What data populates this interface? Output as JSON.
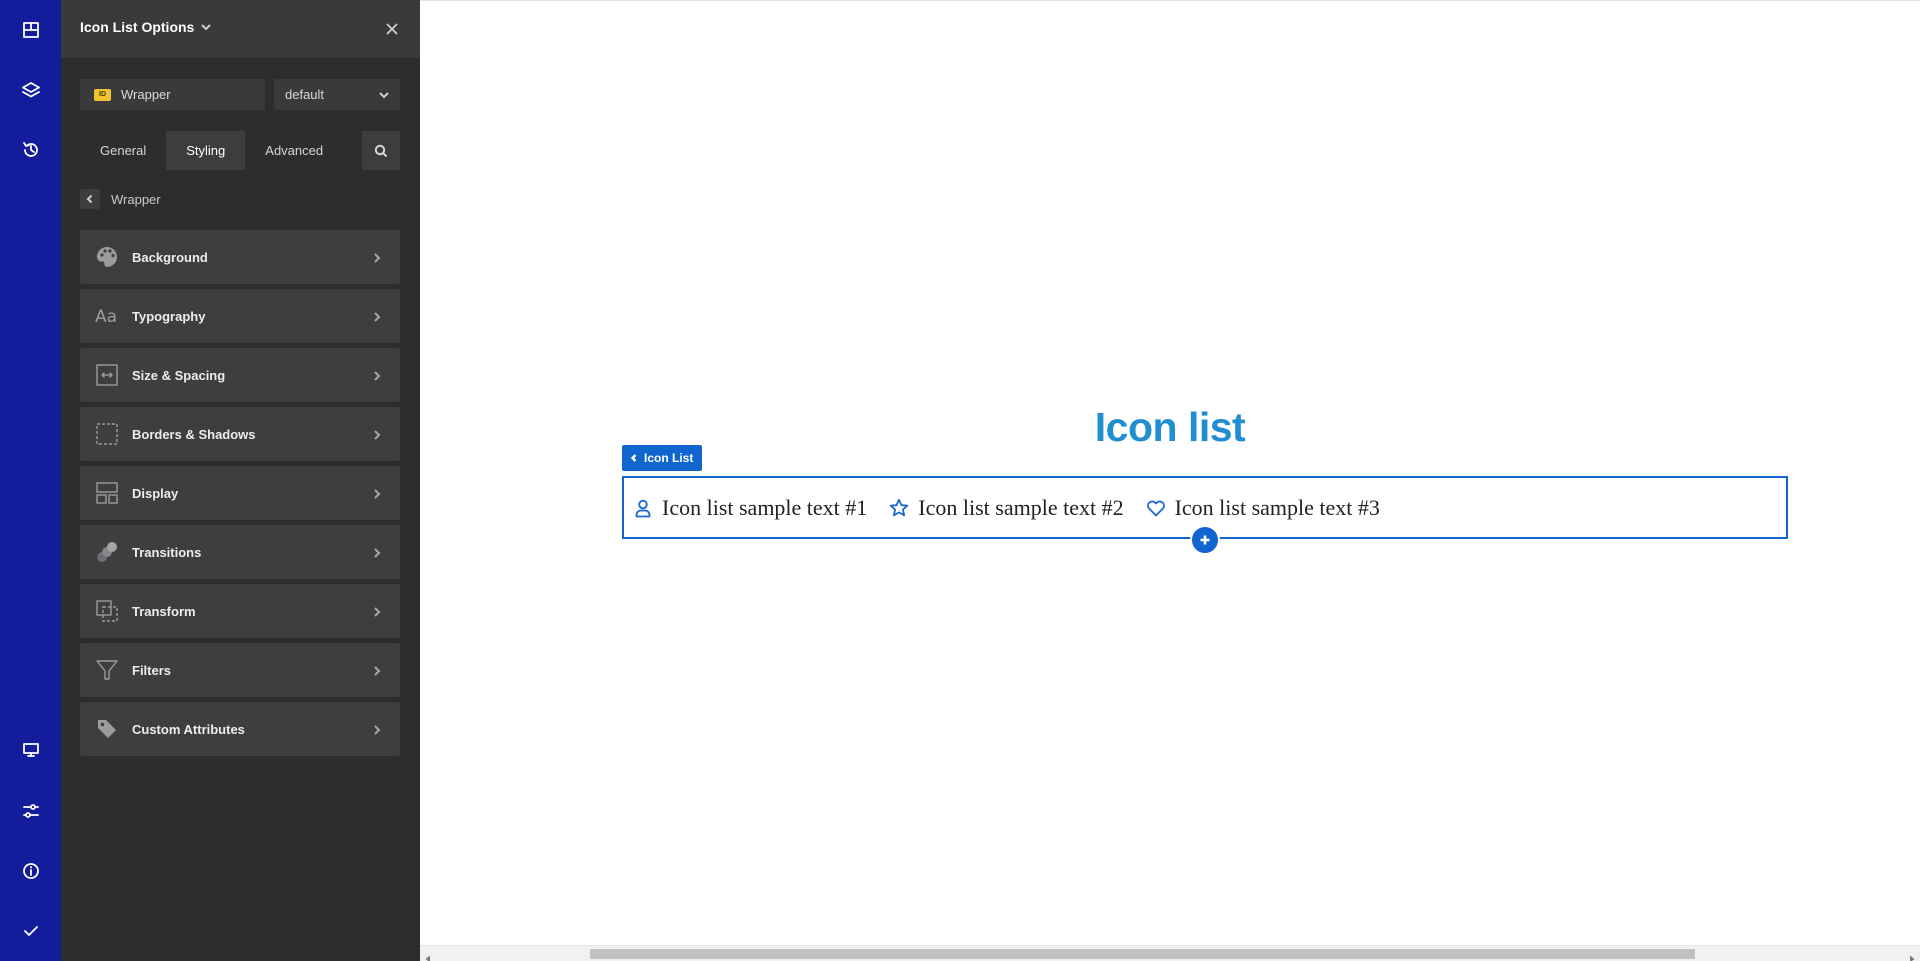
{
  "rail": {
    "top_icons": [
      "elements-icon",
      "layers-icon",
      "history-icon"
    ],
    "bottom_icons": [
      "desktop-icon",
      "settings-icon",
      "info-icon",
      "check-icon"
    ]
  },
  "panel": {
    "title": "Icon List Options",
    "selector": {
      "id_badge": "ID",
      "class_value": "Wrapper",
      "state_value": "default"
    },
    "tabs": [
      {
        "label": "General"
      },
      {
        "label": "Styling"
      },
      {
        "label": "Advanced"
      }
    ],
    "active_tab": "Styling",
    "breadcrumb": "Wrapper",
    "sections": [
      {
        "label": "Background",
        "icon": "palette-icon"
      },
      {
        "label": "Typography",
        "icon": "typography-icon"
      },
      {
        "label": "Size & Spacing",
        "icon": "size-spacing-icon"
      },
      {
        "label": "Borders & Shadows",
        "icon": "borders-icon"
      },
      {
        "label": "Display",
        "icon": "display-icon"
      },
      {
        "label": "Transitions",
        "icon": "transitions-icon"
      },
      {
        "label": "Transform",
        "icon": "transform-icon"
      },
      {
        "label": "Filters",
        "icon": "filter-icon"
      },
      {
        "label": "Custom Attributes",
        "icon": "tag-icon"
      }
    ]
  },
  "canvas": {
    "heading": "Icon list",
    "element_tag": "Icon List",
    "list_items": [
      {
        "text": "Icon list sample text #1",
        "icon": "user-icon"
      },
      {
        "text": "Icon list sample text #2",
        "icon": "star-icon"
      },
      {
        "text": "Icon list sample text #3",
        "icon": "heart-icon"
      }
    ]
  },
  "colors": {
    "rail": "#131d9c",
    "panel": "#2d2d30",
    "accent": "#1065cf",
    "heading": "#1f8fd1"
  }
}
